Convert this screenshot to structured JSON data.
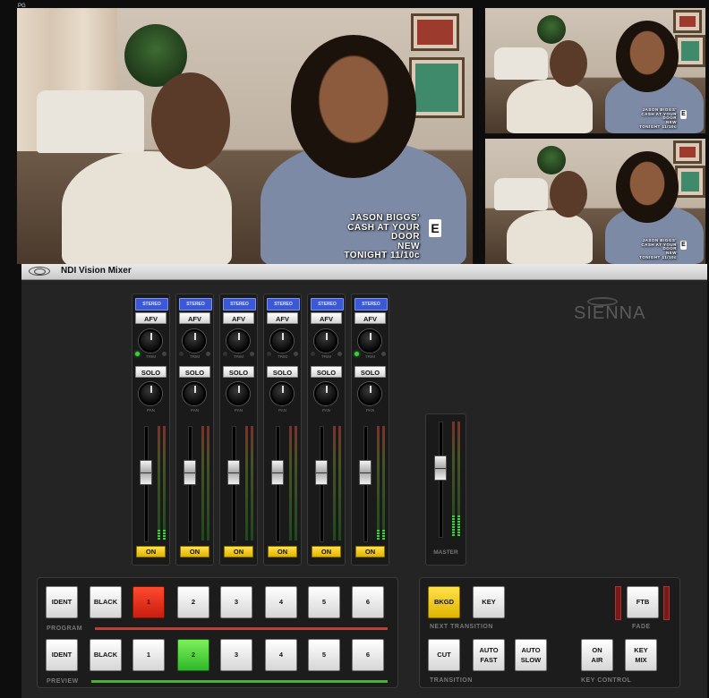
{
  "video": {
    "main": {
      "lower_third": [
        "JASON BIGGS'",
        "CASH AT YOUR DOOR",
        "NEW",
        "TONIGHT 11/10c"
      ],
      "logo": "E"
    },
    "top_right": {
      "lower_third": [
        "JASON BIGGS'",
        "CASH AT YOUR DOOR",
        "NEW",
        "TONIGHT 11/10c"
      ],
      "logo": "E"
    },
    "bottom_right": {
      "lower_third": [
        "JASON BIGGS'",
        "CASH AT YOUR DOOR",
        "NEW",
        "TONIGHT 11/10c"
      ],
      "logo": "E"
    },
    "corner_label": "PG"
  },
  "window": {
    "title": "NDI Vision Mixer"
  },
  "brand": "SIENNA",
  "channels": [
    {
      "top": "STEREO",
      "afv": "AFV",
      "trim": "TRIM",
      "solo": "SOLO",
      "pan": "PAN",
      "on": "ON",
      "trim_led": true,
      "fader_level": 0.42,
      "meter_level": 0.09
    },
    {
      "top": "STEREO",
      "afv": "AFV",
      "trim": "TRIM",
      "solo": "SOLO",
      "pan": "PAN",
      "on": "ON",
      "trim_led": false,
      "fader_level": 0.42,
      "meter_level": 0.0
    },
    {
      "top": "STEREO",
      "afv": "AFV",
      "trim": "TRIM",
      "solo": "SOLO",
      "pan": "PAN",
      "on": "ON",
      "trim_led": false,
      "fader_level": 0.42,
      "meter_level": 0.0
    },
    {
      "top": "STEREO",
      "afv": "AFV",
      "trim": "TRIM",
      "solo": "SOLO",
      "pan": "PAN",
      "on": "ON",
      "trim_led": false,
      "fader_level": 0.42,
      "meter_level": 0.0
    },
    {
      "top": "STEREO",
      "afv": "AFV",
      "trim": "TRIM",
      "solo": "SOLO",
      "pan": "PAN",
      "on": "ON",
      "trim_led": false,
      "fader_level": 0.42,
      "meter_level": 0.0
    },
    {
      "top": "STEREO",
      "afv": "AFV",
      "trim": "TRIM",
      "solo": "SOLO",
      "pan": "PAN",
      "on": "ON",
      "trim_led": true,
      "fader_level": 0.42,
      "meter_level": 0.09
    }
  ],
  "master": {
    "label": "MASTER",
    "fader_level": 0.42,
    "meter_level": 0.18
  },
  "program": {
    "label": "PROGRAM",
    "buttons": [
      "IDENT",
      "BLACK",
      "1",
      "2",
      "3",
      "4",
      "5",
      "6"
    ],
    "active": "1",
    "bar_color": "#b8423a"
  },
  "preview": {
    "label": "PREVIEW",
    "buttons": [
      "IDENT",
      "BLACK",
      "1",
      "2",
      "3",
      "4",
      "5",
      "6"
    ],
    "active": "2",
    "bar_color": "#4caf3a"
  },
  "next_transition": {
    "label": "NEXT TRANSITION",
    "bkgd": "BKGD",
    "key": "KEY"
  },
  "fade": {
    "label": "FADE",
    "ftb": "FTB"
  },
  "transition": {
    "label": "TRANSITION",
    "cut": "CUT",
    "auto_fast": [
      "AUTO",
      "FAST"
    ],
    "auto_slow": [
      "AUTO",
      "SLOW"
    ]
  },
  "key_control": {
    "label": "KEY CONTROL",
    "on_air": [
      "ON",
      "AIR"
    ],
    "key_mix": [
      "KEY",
      "MIX"
    ]
  },
  "colors": {
    "program_red": "#e0281a",
    "preview_green": "#46c83a",
    "stereo_blue": "#3b58d6",
    "on_yellow": "#f2c51a"
  }
}
